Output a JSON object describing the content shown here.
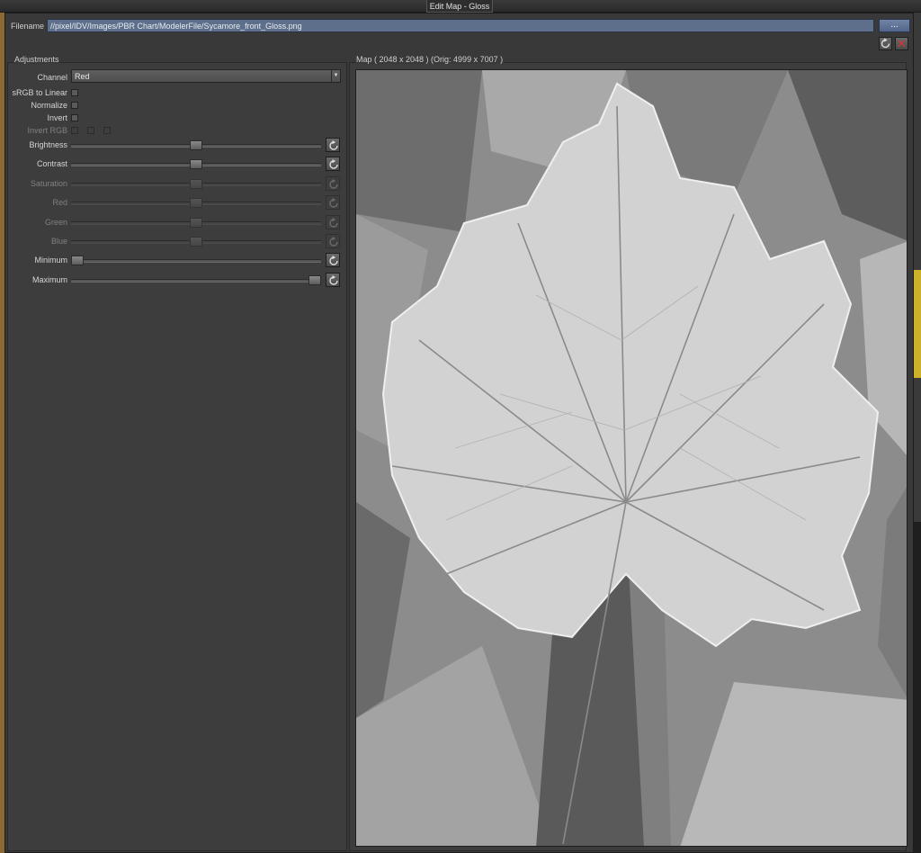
{
  "window": {
    "title": "Edit Map - Gloss"
  },
  "file": {
    "label": "Filename",
    "value": "//pixel/IDV/Images/PBR Chart/ModelerFile/Sycamore_front_Gloss.png",
    "browse_label": "..."
  },
  "adjustments": {
    "title": "Adjustments",
    "channel": {
      "label": "Channel",
      "value": "Red"
    },
    "checkboxes": [
      {
        "label": "sRGB to Linear",
        "checked": false,
        "enabled": true
      },
      {
        "label": "Normalize",
        "checked": false,
        "enabled": true
      },
      {
        "label": "Invert",
        "checked": false,
        "enabled": true
      }
    ],
    "invert_rgb": {
      "label": "Invert RGB",
      "enabled": false
    },
    "sliders": [
      {
        "label": "Brightness",
        "value": 0.5,
        "enabled": true
      },
      {
        "label": "Contrast",
        "value": 0.5,
        "enabled": true
      },
      {
        "label": "Saturation",
        "value": 0.5,
        "enabled": false
      },
      {
        "label": "Red",
        "value": 0.5,
        "enabled": false
      },
      {
        "label": "Green",
        "value": 0.5,
        "enabled": false
      },
      {
        "label": "Blue",
        "value": 0.5,
        "enabled": false
      },
      {
        "label": "Minimum",
        "value": 0.0,
        "enabled": true
      },
      {
        "label": "Maximum",
        "value": 1.0,
        "enabled": true
      }
    ]
  },
  "map": {
    "label": "Map  ( 2048 x 2048 ) (Orig: 4999 x 7007 )"
  },
  "colors": {
    "accent": "#5d6f8a",
    "panel": "#3d3d3d",
    "close": "#e03030"
  }
}
